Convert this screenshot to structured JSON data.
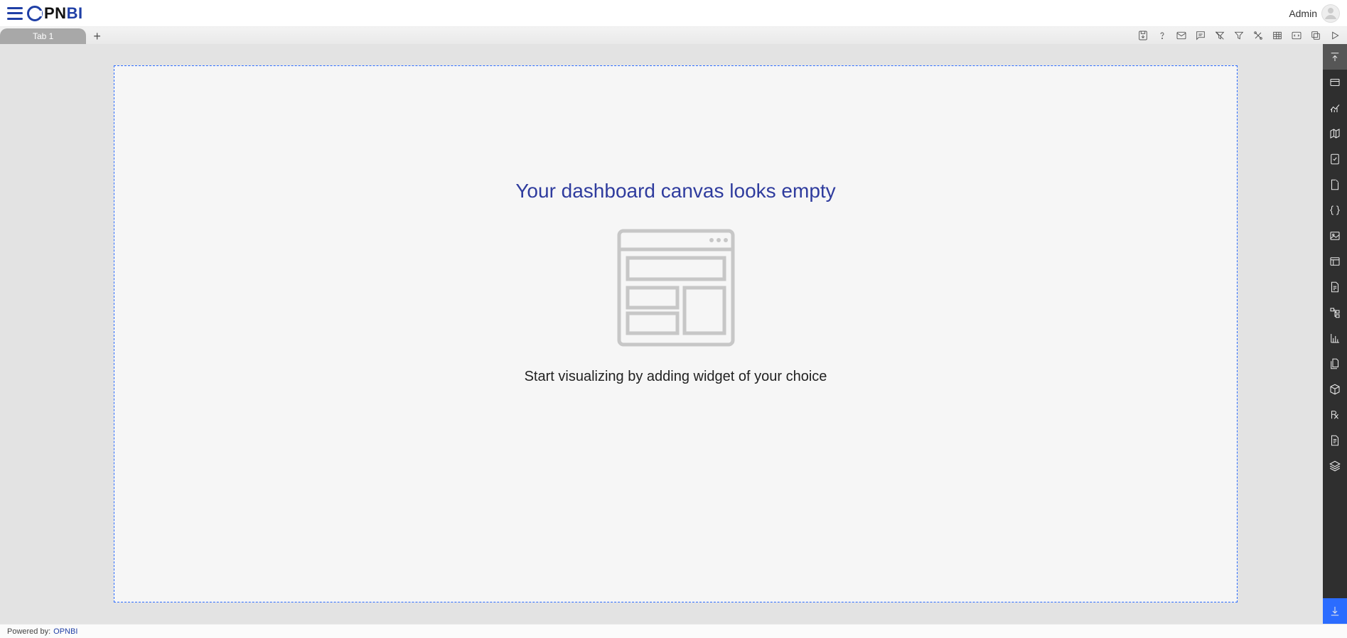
{
  "header": {
    "logo_text_pn": "PN",
    "logo_text_bi": "BI",
    "user_label": "Admin"
  },
  "tabs": {
    "items": [
      {
        "label": "Tab 1"
      }
    ],
    "add_symbol": "+"
  },
  "toolbar": {
    "icons": [
      "save",
      "help",
      "mail",
      "comment",
      "filter-off",
      "filter",
      "tools",
      "table",
      "embed",
      "copy",
      "play"
    ]
  },
  "canvas": {
    "empty_title": "Your dashboard canvas looks empty",
    "empty_subtitle": "Start visualizing by adding widget of your choice"
  },
  "rail": {
    "items": [
      "collapse",
      "card",
      "chart",
      "map",
      "summary",
      "file",
      "braces",
      "image",
      "container",
      "page",
      "tree",
      "bar-chart",
      "file-copy",
      "cube",
      "rx",
      "file-alt",
      "layers",
      "import"
    ]
  },
  "footer": {
    "powered_label": "Powered by:",
    "powered_link": "OPNBI"
  }
}
